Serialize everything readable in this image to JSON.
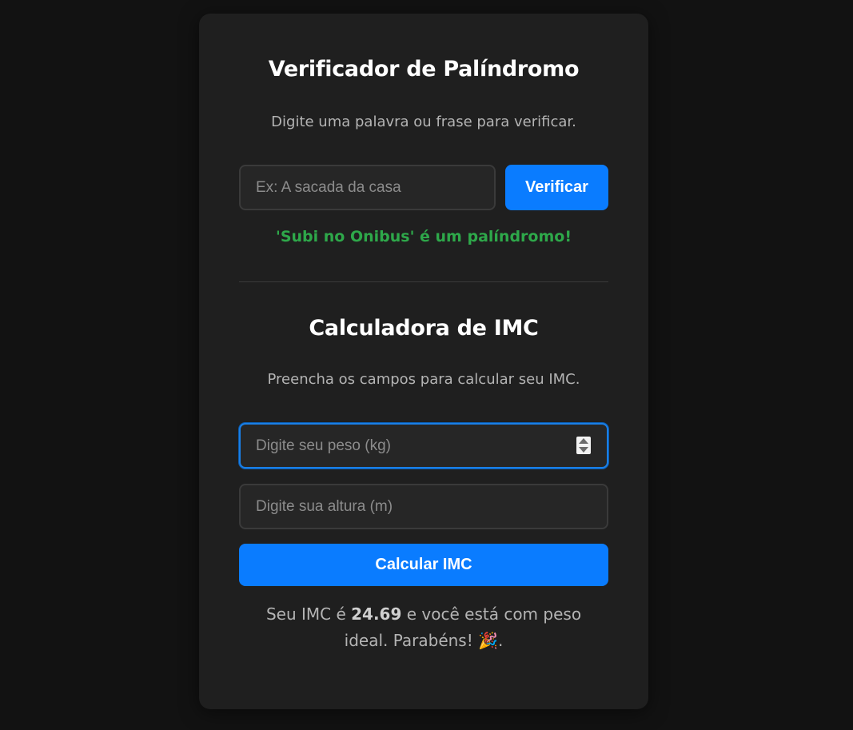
{
  "palindrome": {
    "title": "Verificador de Palíndromo",
    "subtitle": "Digite uma palavra ou frase para verificar.",
    "input_placeholder": "Ex: A sacada da casa",
    "input_value": "",
    "button_label": "Verificar",
    "result": "'Subi no Onibus' é um palíndromo!"
  },
  "imc": {
    "title": "Calculadora de IMC",
    "subtitle": "Preencha os campos para calcular seu IMC.",
    "weight_placeholder": "Digite seu peso (kg)",
    "height_placeholder": "Digite sua altura (m)",
    "button_label": "Calcular IMC",
    "result_prefix": "Seu IMC é",
    "result_value": "24.69",
    "result_suffix": "e você está com peso ideal. Parabéns!",
    "result_emoji": "🎉",
    "result_end": "."
  },
  "colors": {
    "background": "#121212",
    "card": "#1f1f1f",
    "accent": "#0a7cff",
    "success": "#2ea84a"
  }
}
